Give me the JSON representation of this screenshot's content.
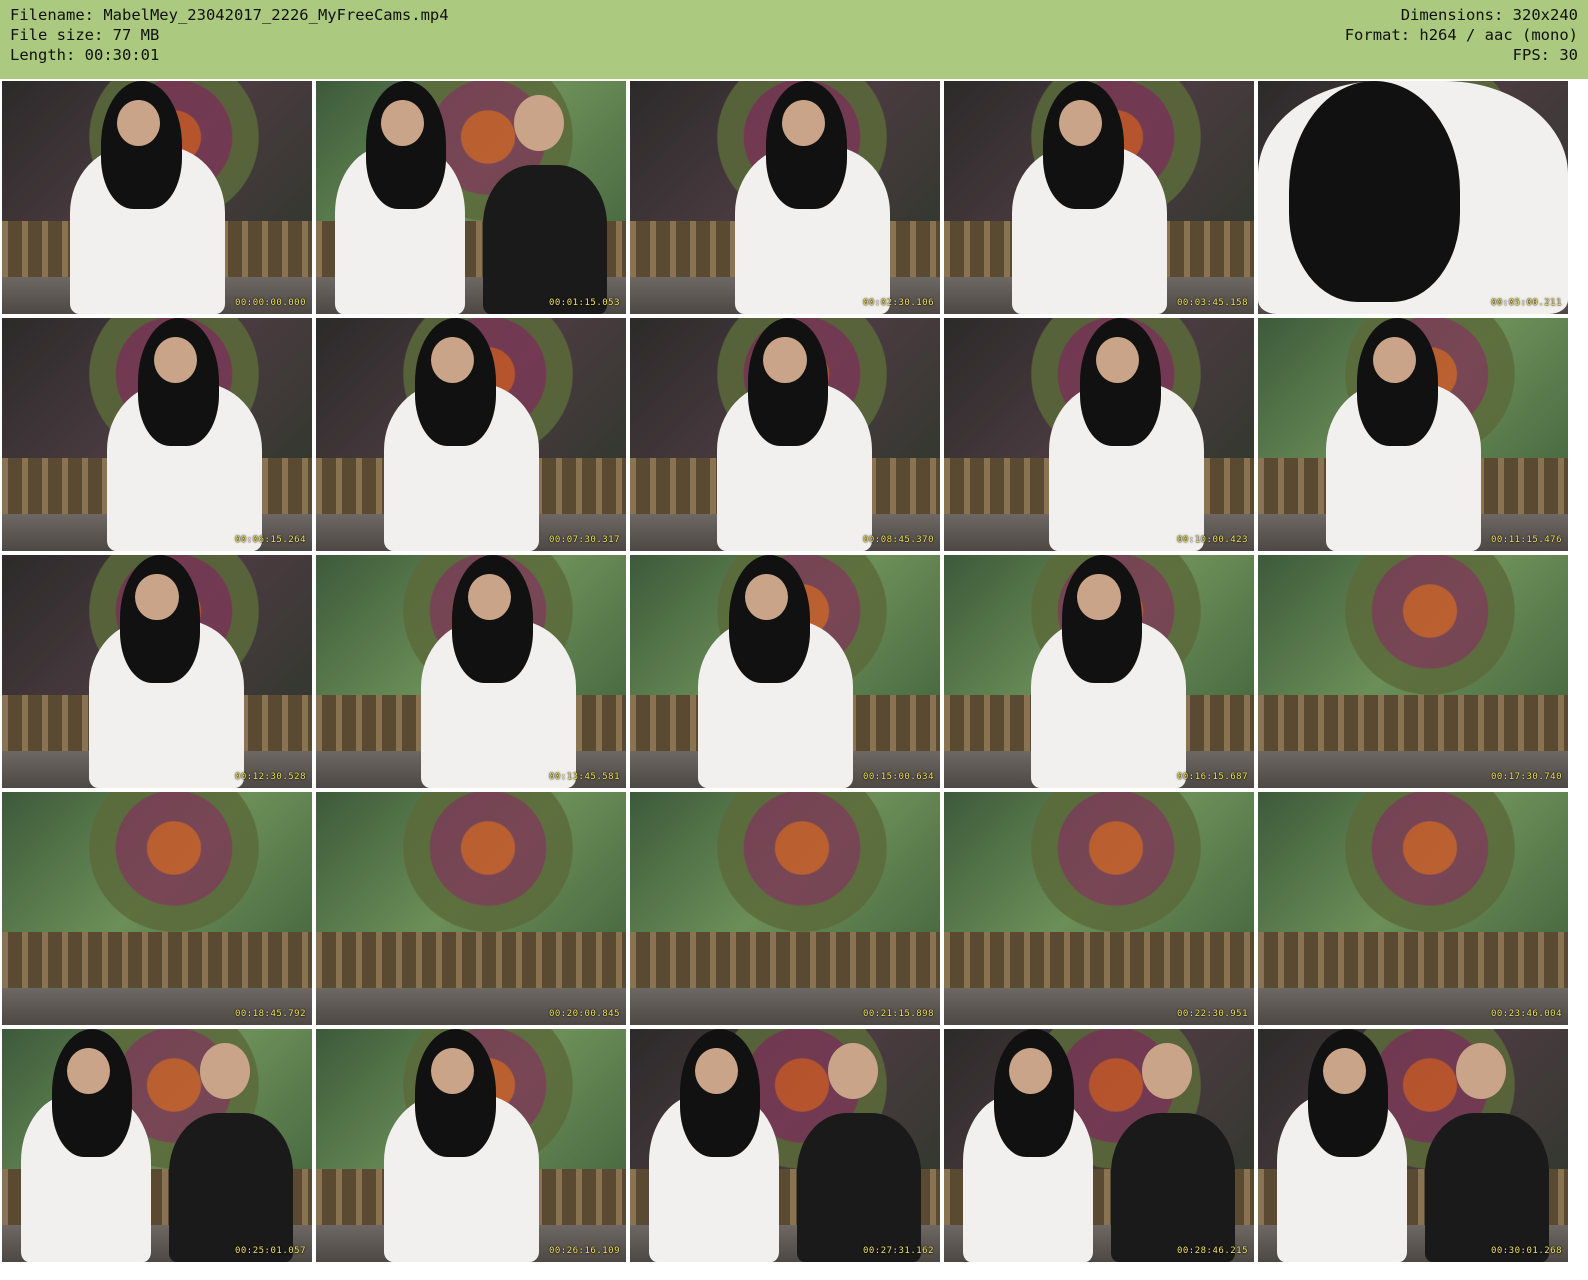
{
  "header": {
    "filename": "Filename: MabelMey_23042017_2226_MyFreeCams.mp4",
    "filesize": "File size: 77 MB",
    "length": "Length: 00:30:01",
    "dimensions": "Dimensions: 320x240",
    "format": "Format: h264 / aac (mono)",
    "fps": "FPS: 30"
  },
  "colors": {
    "header_bg": "#abc97f",
    "timestamp": "#f2e45a"
  },
  "thumbnails": [
    {
      "timestamp": "00:00:00.000",
      "scene": "dark",
      "subject": "white-shirt"
    },
    {
      "timestamp": "00:01:15.053",
      "scene": "green",
      "subject": "two-people"
    },
    {
      "timestamp": "00:02:30.106",
      "scene": "dark",
      "subject": "white-shirt"
    },
    {
      "timestamp": "00:03:45.158",
      "scene": "dark",
      "subject": "white-shirt"
    },
    {
      "timestamp": "00:05:00.211",
      "scene": "dark",
      "subject": "hair-closeup"
    },
    {
      "timestamp": "00:06:15.264",
      "scene": "dark",
      "subject": "white-shirt"
    },
    {
      "timestamp": "00:07:30.317",
      "scene": "dark",
      "subject": "white-shirt"
    },
    {
      "timestamp": "00:08:45.370",
      "scene": "dark",
      "subject": "white-shirt"
    },
    {
      "timestamp": "00:10:00.423",
      "scene": "dark",
      "subject": "white-shirt"
    },
    {
      "timestamp": "00:11:15.476",
      "scene": "green",
      "subject": "white-shirt"
    },
    {
      "timestamp": "00:12:30.528",
      "scene": "dark",
      "subject": "white-shirt"
    },
    {
      "timestamp": "00:13:45.581",
      "scene": "green",
      "subject": "white-shirt"
    },
    {
      "timestamp": "00:15:00.634",
      "scene": "green",
      "subject": "white-shirt"
    },
    {
      "timestamp": "00:16:15.687",
      "scene": "green",
      "subject": "white-shirt"
    },
    {
      "timestamp": "00:17:30.740",
      "scene": "green",
      "subject": "empty"
    },
    {
      "timestamp": "00:18:45.792",
      "scene": "green",
      "subject": "empty"
    },
    {
      "timestamp": "00:20:00.845",
      "scene": "green",
      "subject": "empty"
    },
    {
      "timestamp": "00:21:15.898",
      "scene": "green",
      "subject": "empty"
    },
    {
      "timestamp": "00:22:30.951",
      "scene": "green",
      "subject": "empty"
    },
    {
      "timestamp": "00:23:46.004",
      "scene": "green",
      "subject": "empty"
    },
    {
      "timestamp": "00:25:01.057",
      "scene": "green",
      "subject": "two-people"
    },
    {
      "timestamp": "00:26:16.109",
      "scene": "green",
      "subject": "white-shirt"
    },
    {
      "timestamp": "00:27:31.162",
      "scene": "dark",
      "subject": "two-people"
    },
    {
      "timestamp": "00:28:46.215",
      "scene": "dark",
      "subject": "two-people"
    },
    {
      "timestamp": "00:30:01.268",
      "scene": "dark",
      "subject": "two-people"
    }
  ]
}
